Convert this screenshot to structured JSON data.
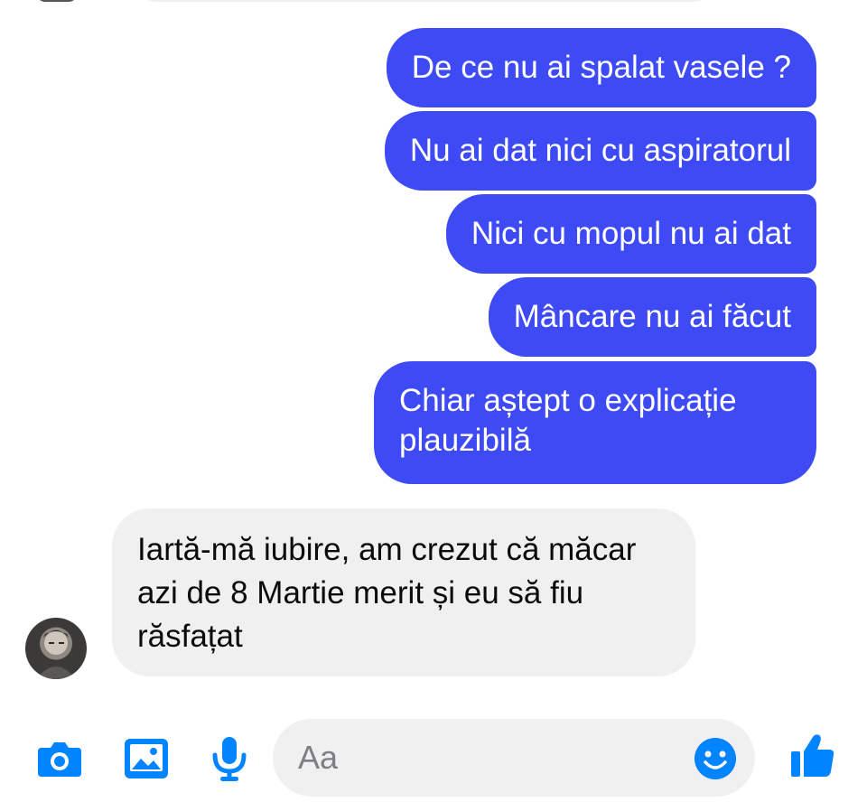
{
  "conversation": {
    "outgoing": [
      "De ce nu ai spalat vasele ?",
      "Nu ai dat nici cu aspiratorul",
      "Nici cu mopul nu ai dat",
      "Mâncare nu ai făcut",
      "Chiar aștept o explicație plauzibilă"
    ],
    "incoming": [
      "Iartă-mă iubire, am crezut că măcar azi de 8 Martie merit și eu să fiu răsfațat"
    ]
  },
  "composer": {
    "placeholder": "Aa",
    "icons": [
      "camera-icon",
      "image-icon",
      "microphone-icon",
      "emoji-icon",
      "thumbs-up-icon"
    ]
  },
  "colors": {
    "accent": "#0084ff",
    "outgoing_bubble": "#3e4af4",
    "incoming_bubble": "#f0f0f0"
  }
}
